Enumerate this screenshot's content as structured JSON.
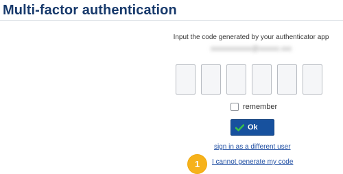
{
  "header": {
    "title": "Multi-factor authentication"
  },
  "form": {
    "instruction": "Input the code generated by your authenticator app",
    "account_email": "xxxxxxxxxxxx@xxxxxx.xxx",
    "code_digits": [
      "",
      "",
      "",
      "",
      "",
      ""
    ],
    "remember_label": "remember",
    "remember_checked": false,
    "ok_label": "Ok",
    "ok_icon": "checkmark-icon",
    "ok_color": "#17519e"
  },
  "links": {
    "different_user": "sign in as a different user",
    "cannot_generate": "I cannot generate my code"
  },
  "annotation": {
    "step_number": "1",
    "badge_color": "#f6b21b"
  }
}
